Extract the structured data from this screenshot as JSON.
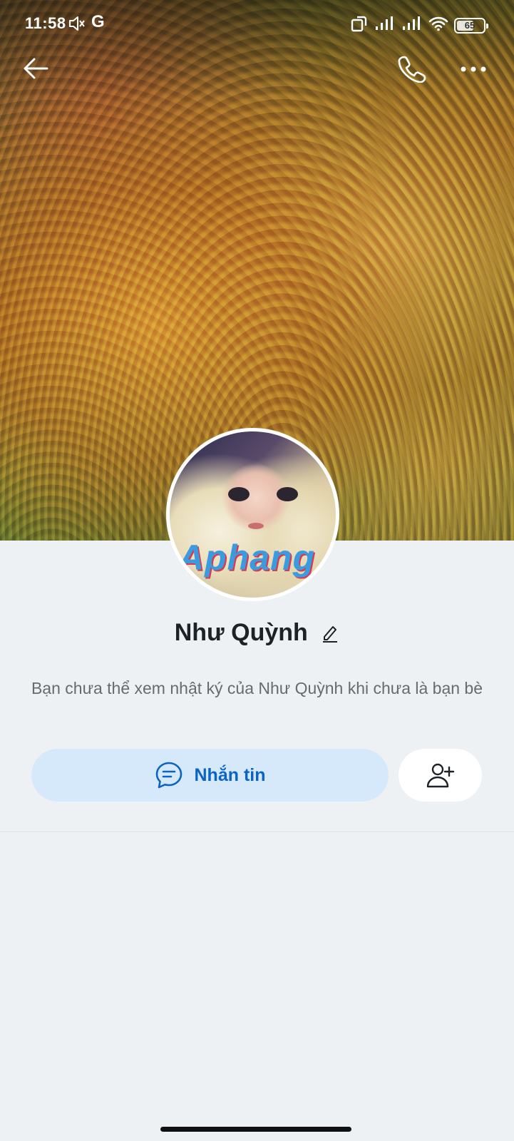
{
  "status_bar": {
    "time": "11:58",
    "carrier_icon": "G",
    "battery": "65",
    "battery_level": 0.65
  },
  "header": {
    "back_icon": "arrow-left-icon",
    "call_icon": "phone-icon",
    "more_icon": "more-horizontal-icon"
  },
  "avatar": {
    "watermark": "Aphang"
  },
  "profile": {
    "name": "Như Quỳnh",
    "notice": "Bạn chưa thể xem nhật ký của Như Quỳnh khi chưa là bạn bè"
  },
  "actions": {
    "message_label": "Nhắn tin",
    "message_icon": "chat-bubble-icon",
    "add_friend_icon": "user-plus-icon"
  },
  "colors": {
    "accent": "#0b63c8",
    "message_button_bg": "#d6e9fb",
    "page_bg": "#eef1f3"
  }
}
